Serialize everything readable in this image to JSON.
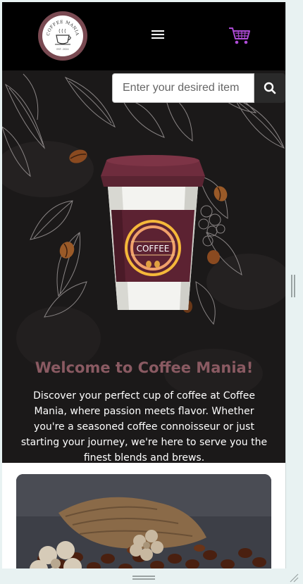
{
  "header": {
    "logo_text_top": "COFFEE MANIA",
    "logo_text_bottom": "EST. 2024",
    "menu_icon": "hamburger-menu-icon",
    "cart_icon": "shopping-cart-icon"
  },
  "search": {
    "placeholder": "Enter your desired item",
    "button_icon": "search-icon"
  },
  "hero": {
    "cup_label": "COFFEE",
    "title": "Welcome to Coffee Mania!",
    "text": "Discover your perfect cup of coffee at Coffee Mania, where passion meets flavor. Whether you're a seasoned coffee connoisseur or just starting your journey, we're here to serve you the finest blends and brews."
  },
  "colors": {
    "header_bg": "#000000",
    "hero_bg": "#1b1919",
    "accent": "#8a5a62",
    "cart": "#b04cd8"
  }
}
